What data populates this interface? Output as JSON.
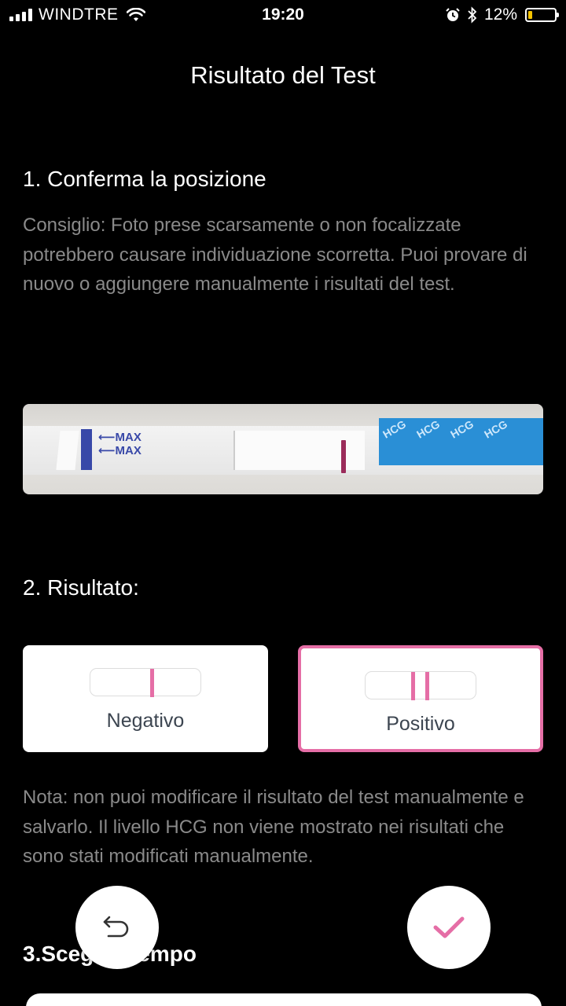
{
  "status_bar": {
    "carrier": "WINDTRE",
    "time": "19:20",
    "battery_percent": "12%",
    "icons": [
      "signal-icon",
      "wifi-icon",
      "alarm-icon",
      "bluetooth-icon",
      "battery-icon"
    ]
  },
  "header": {
    "title": "Risultato del Test"
  },
  "section1": {
    "title": "1. Conferma la posizione",
    "tip": "Consiglio: Foto prese scarsamente o non focalizzate potrebbero causare individuazione scorretta. Puoi provare di nuovo o aggiungere manualmente i risultati del test."
  },
  "strip_photo": {
    "max_labels": [
      "MAX",
      "MAX"
    ],
    "wrapper_text": "HCG"
  },
  "section2": {
    "title": "2. Risultato:",
    "options": [
      {
        "label": "Negativo",
        "lines": 1,
        "selected": false
      },
      {
        "label": "Positivo",
        "lines": 2,
        "selected": true
      }
    ],
    "note": "Nota: non puoi modificare il risultato del test manualmente e salvarlo. Il livello HCG non viene mostrato nei risultati che sono stati modificati manualmente."
  },
  "section3": {
    "title": "3.Scegli il tempo"
  },
  "actions": {
    "undo": "undo-icon",
    "confirm": "check-icon"
  },
  "colors": {
    "accent": "#e56ea6",
    "background": "#000000",
    "muted_text": "#8a8a8a",
    "card_text": "#3c4550",
    "battery_fill": "#f5c400"
  }
}
